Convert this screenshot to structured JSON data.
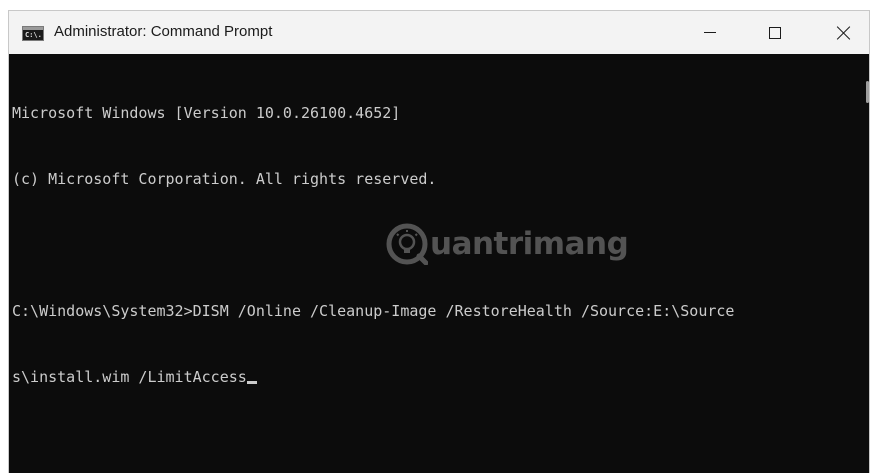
{
  "window": {
    "title": "Administrator: Command Prompt",
    "app_icon_glyph": "C:\\."
  },
  "controls": {
    "minimize_icon": "minimize-icon",
    "maximize_icon": "maximize-icon",
    "close_icon": "close-icon"
  },
  "console": {
    "lines": [
      "Microsoft Windows [Version 10.0.26100.4652]",
      "(c) Microsoft Corporation. All rights reserved.",
      "",
      "C:\\Windows\\System32>DISM /Online /Cleanup-Image /RestoreHealth /Source:E:\\Source",
      "s\\install.wim /LimitAccess"
    ],
    "text_color": "#cccccc",
    "background": "#0c0c0c"
  },
  "watermark": {
    "text": "uantrimang"
  }
}
